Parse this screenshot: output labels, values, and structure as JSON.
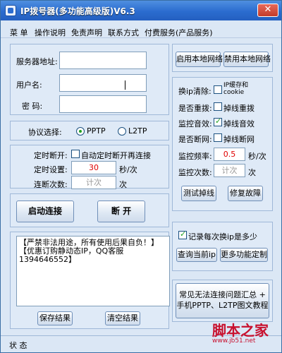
{
  "window": {
    "title": "IP拨号器(多功能高级版)V6.3"
  },
  "menu": [
    "菜 单",
    "操作说明",
    "免责声明",
    "联系方式",
    "付费服务(产品服务)"
  ],
  "login": {
    "server_label": "服务器地址:",
    "user_label": "用户名:",
    "password_label": "密  码:",
    "server_value": "",
    "user_value": "",
    "password_value": ""
  },
  "protocol": {
    "label": "协议选择:",
    "options": [
      "PPTP",
      "L2TP"
    ],
    "selected": "PPTP"
  },
  "timer": {
    "timed_disconnect_label": "定时断开:",
    "auto_reconnect_label": "自动定时断开再连接",
    "auto_reconnect_checked": false,
    "timer_setting_label": "定时设置:",
    "timer_value": "30",
    "timer_unit": "秒/次",
    "disconnect_count_label": "连断次数:",
    "count_placeholder": "计次",
    "count_unit": "次"
  },
  "actions": {
    "connect": "启动连接",
    "disconnect": "断 开"
  },
  "log": {
    "lines": [
      "【严禁非法用途，所有使用后果自负！】",
      "【优惠订购静动态IP，QQ客服1394646552】"
    ],
    "save": "保存结果",
    "clear": "清空结果"
  },
  "network": {
    "enable": "启用本地网络",
    "disable": "禁用本地网络"
  },
  "options": {
    "ip_clear_label": "换ip清除:",
    "ip_clear_option": "IP缓存和cookie",
    "ip_clear_checked": false,
    "redial_label": "是否重拨:",
    "redial_option": "掉线重拨",
    "redial_checked": false,
    "sound_label": "监控音效:",
    "sound_option": "掉线音效",
    "sound_checked": true,
    "offline_label": "是否断网:",
    "offline_option": "掉线断网",
    "offline_checked": false,
    "freq_label": "监控频率:",
    "freq_value": "0.5",
    "freq_unit": "秒/次",
    "count_label": "监控次数:",
    "count_placeholder": "计次",
    "count_unit": "次",
    "test_btn": "测试掉线",
    "fix_btn": "修复故障"
  },
  "record": {
    "label": "记录每次换ip是多少",
    "checked": true,
    "query_btn": "查询当前ip",
    "more_btn": "更多功能定制"
  },
  "help": {
    "line1": "常见无法连接问题汇总 +",
    "line2": "手机PPTP、L2TP图文教程"
  },
  "status": {
    "label": "状 态"
  },
  "watermark": {
    "main": "脚本之家",
    "url": "www.jb51.net"
  }
}
